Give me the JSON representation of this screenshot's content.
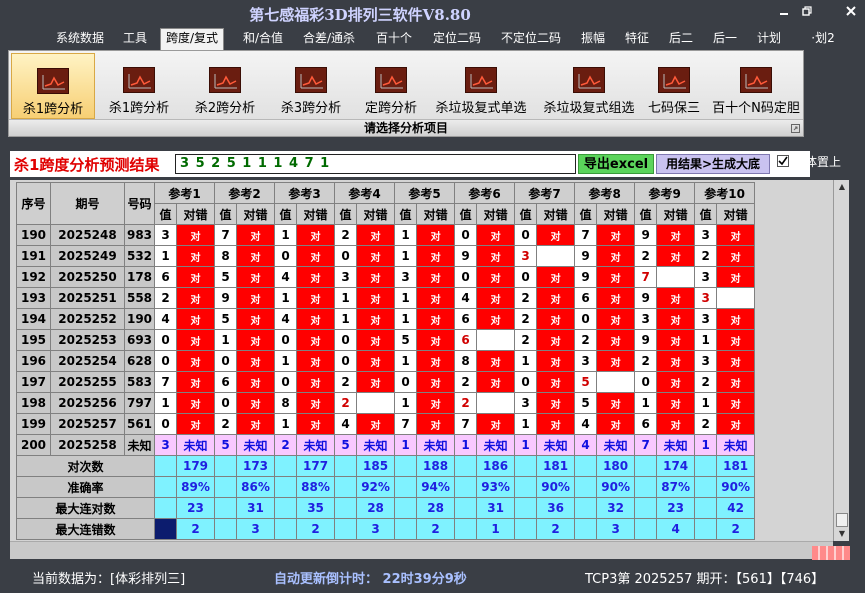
{
  "window": {
    "title": "第七感福彩3D排列三软件V8.80"
  },
  "menu": [
    {
      "label": "系统数据",
      "active": false
    },
    {
      "label": "工具",
      "active": false
    },
    {
      "label": "跨度/复式",
      "active": true
    },
    {
      "label": "和/合值",
      "active": false
    },
    {
      "label": "合差/通杀",
      "active": false
    },
    {
      "label": "百十个",
      "active": false
    },
    {
      "label": "定位二码",
      "active": false
    },
    {
      "label": "不定位二码",
      "active": false
    },
    {
      "label": "振幅",
      "active": false
    },
    {
      "label": "特征",
      "active": false
    },
    {
      "label": "后二",
      "active": false
    },
    {
      "label": "后一",
      "active": false
    },
    {
      "label": "计划",
      "active": false
    },
    {
      "label": "·划2",
      "active": false
    }
  ],
  "ribbon": {
    "buttons": [
      {
        "label": "杀1跨分析",
        "active": true
      },
      {
        "label": "杀1跨分析",
        "active": false
      },
      {
        "label": "杀2跨分析",
        "active": false
      },
      {
        "label": "杀3跨分析",
        "active": false
      },
      {
        "label": "定跨分析",
        "active": false
      },
      {
        "label": "杀垃圾复式单选",
        "active": false
      },
      {
        "label": "杀垃圾复式组选",
        "active": false
      },
      {
        "label": "七码保三",
        "active": false
      },
      {
        "label": "百十个N码定胆",
        "active": false
      }
    ],
    "footer": "请选择分析项目"
  },
  "result": {
    "title": "杀1跨度分析预测结果",
    "value": "3 5 2 5 1 1 1 4 7 1",
    "excel_button": "导出excel",
    "generate_button": "用结果>生成大底",
    "checkbox_label": "窗体置上",
    "checkbox_checked": true
  },
  "table": {
    "headers": {
      "seq": "序号",
      "period": "期号",
      "code": "号码",
      "value": "值",
      "result": "对错"
    },
    "refs": [
      "参考1",
      "参考2",
      "参考3",
      "参考4",
      "参考5",
      "参考6",
      "参考7",
      "参考8",
      "参考9",
      "参考10"
    ],
    "rows": [
      {
        "seq": "190",
        "period": "2025248",
        "code": "983",
        "vals": [
          "3",
          "7",
          "1",
          "2",
          "1",
          "0",
          "0",
          "7",
          "9",
          "3"
        ],
        "res": [
          "对",
          "对",
          "对",
          "对",
          "对",
          "对",
          "对",
          "对",
          "对",
          "对"
        ]
      },
      {
        "seq": "191",
        "period": "2025249",
        "code": "532",
        "vals": [
          "1",
          "8",
          "0",
          "0",
          "1",
          "9",
          "3",
          "9",
          "2",
          "2"
        ],
        "res": [
          "对",
          "对",
          "对",
          "对",
          "对",
          "对",
          "错",
          "对",
          "对",
          "对"
        ]
      },
      {
        "seq": "192",
        "period": "2025250",
        "code": "178",
        "vals": [
          "6",
          "5",
          "4",
          "3",
          "3",
          "0",
          "0",
          "9",
          "7",
          "3"
        ],
        "res": [
          "对",
          "对",
          "对",
          "对",
          "对",
          "对",
          "对",
          "对",
          "错",
          "对"
        ]
      },
      {
        "seq": "193",
        "period": "2025251",
        "code": "558",
        "vals": [
          "2",
          "9",
          "1",
          "1",
          "1",
          "4",
          "2",
          "6",
          "9",
          "3"
        ],
        "res": [
          "对",
          "对",
          "对",
          "对",
          "对",
          "对",
          "对",
          "对",
          "对",
          "错"
        ]
      },
      {
        "seq": "194",
        "period": "2025252",
        "code": "190",
        "vals": [
          "4",
          "5",
          "4",
          "1",
          "1",
          "6",
          "2",
          "0",
          "3",
          "3"
        ],
        "res": [
          "对",
          "对",
          "对",
          "对",
          "对",
          "对",
          "对",
          "对",
          "对",
          "对"
        ]
      },
      {
        "seq": "195",
        "period": "2025253",
        "code": "693",
        "vals": [
          "0",
          "1",
          "0",
          "0",
          "5",
          "6",
          "2",
          "2",
          "9",
          "1"
        ],
        "res": [
          "对",
          "对",
          "对",
          "对",
          "对",
          "错",
          "对",
          "对",
          "对",
          "对"
        ]
      },
      {
        "seq": "196",
        "period": "2025254",
        "code": "628",
        "vals": [
          "0",
          "0",
          "1",
          "0",
          "1",
          "8",
          "1",
          "3",
          "2",
          "3"
        ],
        "res": [
          "对",
          "对",
          "对",
          "对",
          "对",
          "对",
          "对",
          "对",
          "对",
          "对"
        ]
      },
      {
        "seq": "197",
        "period": "2025255",
        "code": "583",
        "vals": [
          "7",
          "6",
          "0",
          "2",
          "0",
          "2",
          "0",
          "5",
          "0",
          "2"
        ],
        "res": [
          "对",
          "对",
          "对",
          "对",
          "对",
          "对",
          "对",
          "错",
          "对",
          "对"
        ]
      },
      {
        "seq": "198",
        "period": "2025256",
        "code": "797",
        "vals": [
          "1",
          "0",
          "8",
          "2",
          "1",
          "2",
          "3",
          "5",
          "1",
          "1"
        ],
        "res": [
          "对",
          "对",
          "对",
          "错",
          "对",
          "错",
          "对",
          "对",
          "对",
          "对"
        ]
      },
      {
        "seq": "199",
        "period": "2025257",
        "code": "561",
        "vals": [
          "0",
          "2",
          "1",
          "4",
          "7",
          "7",
          "1",
          "4",
          "6",
          "2"
        ],
        "res": [
          "对",
          "对",
          "对",
          "对",
          "对",
          "对",
          "对",
          "对",
          "对",
          "对"
        ]
      }
    ],
    "forecast": {
      "seq": "200",
      "period": "2025258",
      "code": "未知",
      "vals": [
        "3",
        "5",
        "2",
        "5",
        "1",
        "1",
        "1",
        "4",
        "7",
        "1"
      ],
      "res": [
        "未知",
        "未知",
        "未知",
        "未知",
        "未知",
        "未知",
        "未知",
        "未知",
        "未知",
        "未知"
      ]
    },
    "stats": [
      {
        "label": "对次数",
        "values": [
          "179",
          "173",
          "177",
          "185",
          "188",
          "186",
          "181",
          "180",
          "174",
          "181"
        ]
      },
      {
        "label": "准确率",
        "values": [
          "89%",
          "86%",
          "88%",
          "92%",
          "94%",
          "93%",
          "90%",
          "90%",
          "87%",
          "90%"
        ]
      },
      {
        "label": "最大连对数",
        "values": [
          "23",
          "31",
          "35",
          "28",
          "28",
          "31",
          "36",
          "32",
          "23",
          "42"
        ]
      },
      {
        "label": "最大连错数",
        "values": [
          "2",
          "3",
          "2",
          "3",
          "2",
          "1",
          "2",
          "3",
          "4",
          "2"
        ]
      }
    ]
  },
  "status": {
    "current_data": "当前数据为：[体彩排列三]",
    "countdown": "自动更新倒计时： 22时39分9秒",
    "draw": "TCP3第 2025257 期开：【561】【746】"
  },
  "colors": {
    "right": "#ff0000",
    "forecast": "#f8c8ff",
    "stats": "#7ff2ff",
    "background": "#3a3e45"
  }
}
